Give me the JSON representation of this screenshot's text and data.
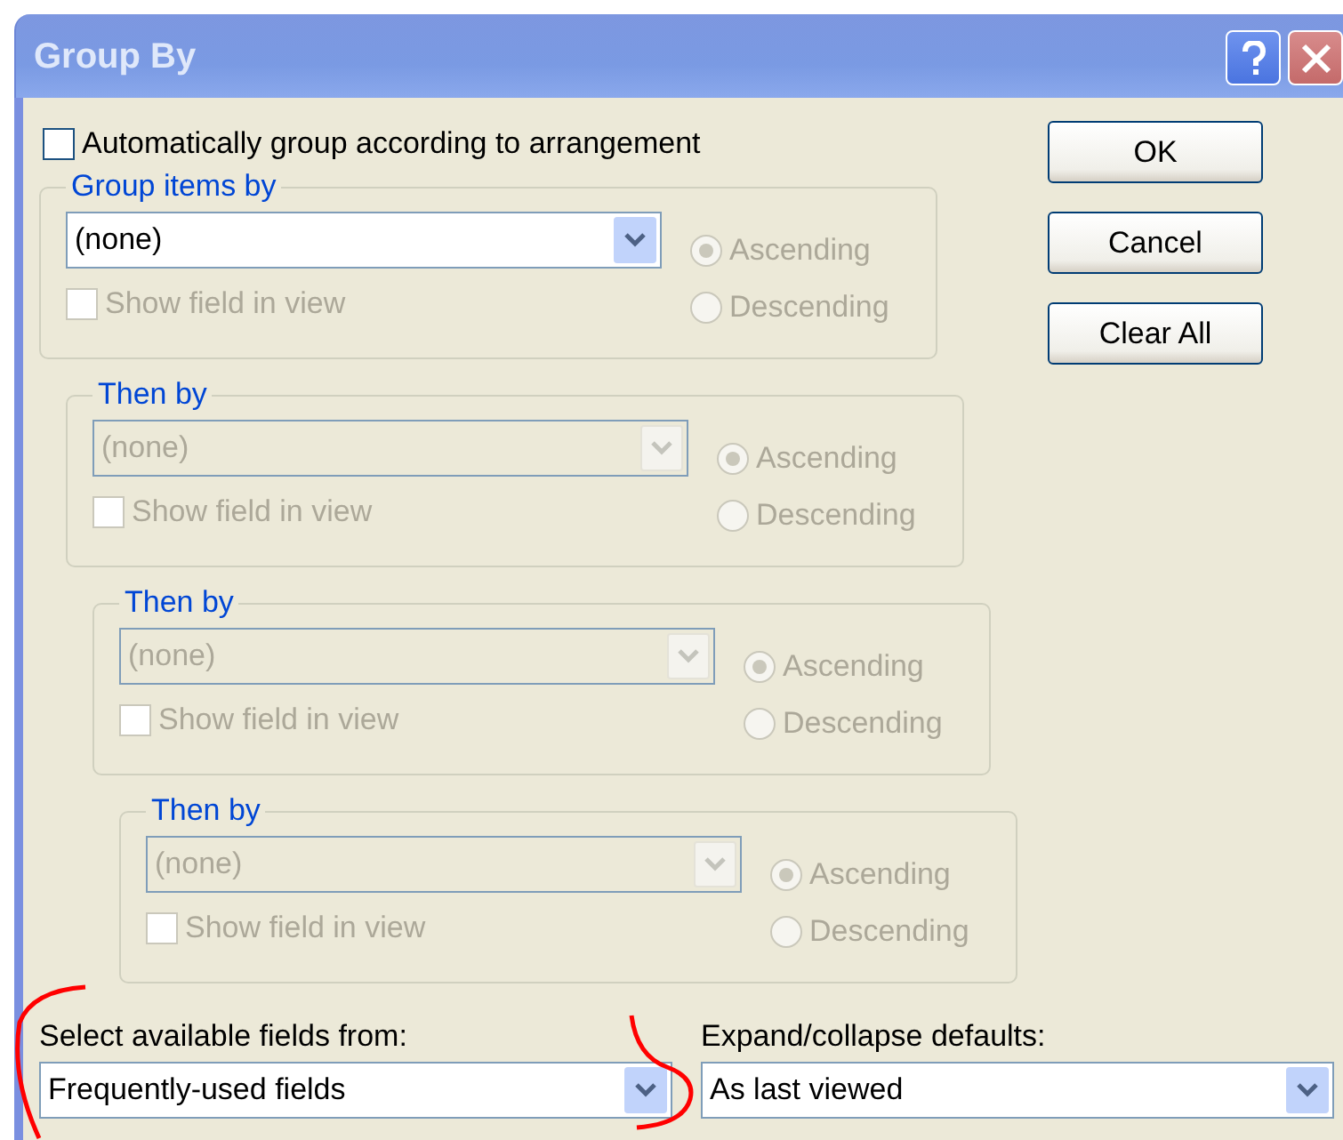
{
  "window": {
    "title": "Group By"
  },
  "auto_group": {
    "label": "Automatically group according to arrangement",
    "checked": false
  },
  "groups": [
    {
      "title": "Group items by",
      "value": "(none)",
      "disabled": false,
      "show_field": {
        "label": "Show field in view",
        "checked": false,
        "disabled": true
      },
      "sort": [
        {
          "label": "Ascending",
          "selected": true
        },
        {
          "label": "Descending",
          "selected": false
        }
      ]
    },
    {
      "title": "Then by",
      "value": "(none)",
      "disabled": true,
      "show_field": {
        "label": "Show field in view",
        "checked": false,
        "disabled": true
      },
      "sort": [
        {
          "label": "Ascending",
          "selected": true
        },
        {
          "label": "Descending",
          "selected": false
        }
      ]
    },
    {
      "title": "Then by",
      "value": "(none)",
      "disabled": true,
      "show_field": {
        "label": "Show field in view",
        "checked": false,
        "disabled": true
      },
      "sort": [
        {
          "label": "Ascending",
          "selected": true
        },
        {
          "label": "Descending",
          "selected": false
        }
      ]
    },
    {
      "title": "Then by",
      "value": "(none)",
      "disabled": true,
      "show_field": {
        "label": "Show field in view",
        "checked": false,
        "disabled": true
      },
      "sort": [
        {
          "label": "Ascending",
          "selected": true
        },
        {
          "label": "Descending",
          "selected": false
        }
      ]
    }
  ],
  "buttons": [
    {
      "label": "OK"
    },
    {
      "label": "Cancel"
    },
    {
      "label": "Clear All"
    }
  ],
  "fields_from": {
    "label": "Select available fields from:",
    "value": "Frequently-used fields"
  },
  "expand_defaults": {
    "label": "Expand/collapse defaults:",
    "value": "As last viewed"
  }
}
